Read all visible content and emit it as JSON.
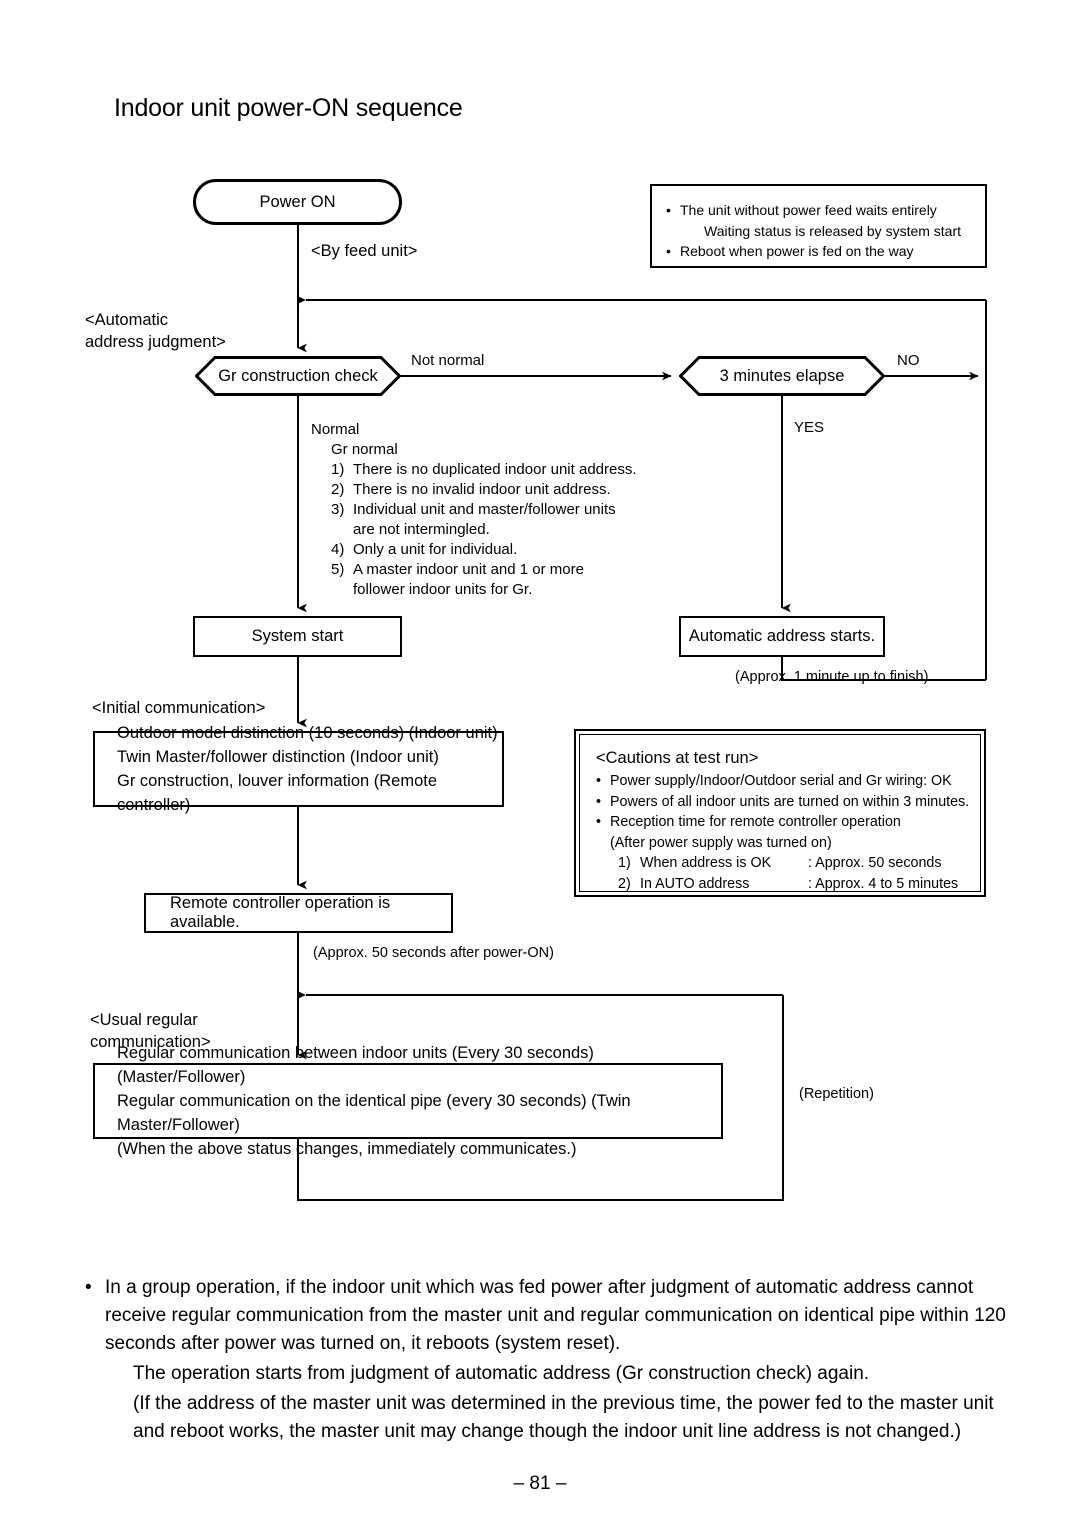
{
  "title": "Indoor unit power-ON sequence",
  "nodes": {
    "power_on": "Power ON",
    "gr_construction_check": "Gr construction check",
    "three_minutes_elapse": "3 minutes elapse",
    "system_start": "System start",
    "automatic_address_starts": "Automatic address starts.",
    "remote_controller": "Remote controller operation is available."
  },
  "edge_labels": {
    "by_feed_unit": "<By feed unit>",
    "automatic_address_judgment_1": "<Automatic",
    "automatic_address_judgment_2": "address judgment>",
    "not_normal": "Not normal",
    "no": "NO",
    "yes": "YES",
    "approx_1_minute": "(Approx. 1 minute up to finish)",
    "initial_communication": "<Initial communication>",
    "approx_50_seconds": "(Approx. 50 seconds after power-ON)",
    "usual_regular_1": "<Usual regular",
    "usual_regular_2": "communication>",
    "repetition": "(Repetition)"
  },
  "note_top": {
    "line1": "The unit without power feed waits entirely",
    "line2": "Waiting status is released by system start",
    "line3": "Reboot when power is fed on the way"
  },
  "normal_list": {
    "header": "Normal",
    "subheader": "Gr normal",
    "items": [
      {
        "num": "1)",
        "text": "There is no duplicated indoor unit address."
      },
      {
        "num": "2)",
        "text": "There is no invalid indoor unit address."
      },
      {
        "num": "3)",
        "text": "Individual unit and master/follower units",
        "cont": "are not intermingled."
      },
      {
        "num": "4)",
        "text": "Only a unit for individual."
      },
      {
        "num": "5)",
        "text": "A master indoor unit and 1 or more",
        "cont": "follower indoor units for Gr."
      }
    ]
  },
  "initial_box": {
    "line1": "Outdoor model distinction (10 seconds) (Indoor unit)",
    "line2": "Twin Master/follower distinction (Indoor unit)",
    "line3": "Gr construction, louver information (Remote controller)"
  },
  "cautions": {
    "title": "<Cautions at test run>",
    "bullets": [
      "Power supply/Indoor/Outdoor serial and Gr wiring: OK",
      "Powers of all indoor units are turned on within 3 minutes.",
      "Reception time for remote controller operation"
    ],
    "sub": "(After power supply was turned on)",
    "numbered": [
      {
        "num": "1)",
        "label": "When address is OK",
        "value": ": Approx. 50 seconds"
      },
      {
        "num": "2)",
        "label": "In AUTO address",
        "value": ": Approx. 4 to 5 minutes"
      }
    ]
  },
  "regular_box": {
    "line1": "Regular communication between indoor units (Every 30 seconds) (Master/Follower)",
    "line2": "Regular communication on the identical pipe (every 30 seconds) (Twin Master/Follower)",
    "line3": "(When the above status changes, immediately communicates.)"
  },
  "footer": {
    "bullet": "•",
    "paragraph1": "In a group operation, if the indoor unit which was fed power after judgment of automatic address cannot receive regular communication from the master unit and regular communication on identical pipe within 120 seconds after power was turned on, it reboots (system reset).",
    "paragraph2": "The operation starts from judgment of automatic address (Gr construction check) again.",
    "paragraph3": "(If the address of the master unit was determined in the previous time, the power fed to the master unit and reboot works, the master unit may change though the indoor unit line address is not changed.)"
  },
  "page_number": "– 81 –",
  "colors": {
    "ink": "#000000",
    "paper": "#ffffff"
  }
}
